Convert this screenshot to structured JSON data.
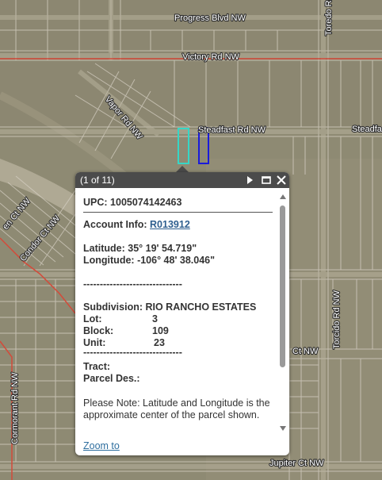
{
  "map": {
    "roads": {
      "progress": "Progress Blvd NW",
      "victory": "Victory Rd NW",
      "steadfast": "Steadfast Rd NW",
      "steadfast_right": "Steadfa",
      "vapor": "Vapor Rd NW",
      "condor": "Condor Ct NW",
      "cormorant": "Cormorant Rd NW",
      "toredo_top": "Toredo Rd NW",
      "toredo_mid": "Torcido Rd NW",
      "jupiter": "Jupiter Ct NW",
      "ct_nw": "Ct NW",
      "left_partial": "en Ct NW"
    },
    "colors": {
      "parcel_line": "#d8d2c6",
      "boundary_red": "#d44a3a",
      "selected_cyan": "#36d6c6",
      "selected_blue": "#1a1adb"
    }
  },
  "popup": {
    "counter": "(1 of 11)",
    "icons": [
      "next-icon",
      "maximize-icon",
      "close-icon"
    ],
    "upc_label": "UPC:",
    "upc_value": "1005074142463",
    "account_label": "Account Info:",
    "account_value": "R013912",
    "latitude_label": "Latitude:",
    "latitude_value": "35° 19' 54.719\"",
    "longitude_label": "Longitude:",
    "longitude_value": "-106° 48' 38.046\"",
    "separator": "------------------------------",
    "subdivision_label": "Subdivision:",
    "subdivision_value": "RIO RANCHO ESTATES",
    "lot_label": "Lot:",
    "lot_value": "3",
    "block_label": "Block:",
    "block_value": "109",
    "unit_label": "Unit:",
    "unit_value": "23",
    "tract_label": "Tract:",
    "parcel_label": "Parcel Des.:",
    "note": "Please Note: Latitude and Longitude is the approximate center of the parcel shown.",
    "zoom_link": "Zoom to"
  }
}
